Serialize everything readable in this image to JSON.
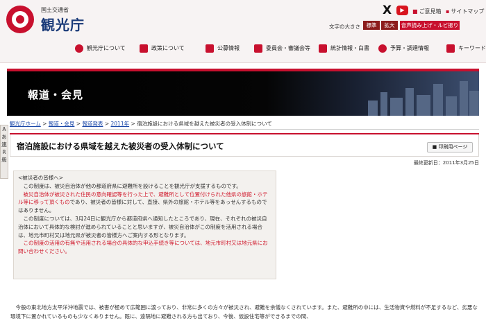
{
  "header": {
    "logo_sub": "国土交通省",
    "logo_main": "観光庁",
    "social_x": "X",
    "social_yt": "▶",
    "opinion_link": "ご意見箱",
    "sitemap_link": "サイトマップ",
    "font_size_label": "文字の大きさ",
    "font_normal": "標準",
    "font_large": "拡大",
    "voice_button": "音声読み上げ・ルビ振り"
  },
  "nav": {
    "items": [
      "観光庁について",
      "政策について",
      "公募情報",
      "委員会・審議会等",
      "統計情報・白書",
      "予算・調達情報",
      "キーワード"
    ]
  },
  "banner": {
    "title": "報道・会見"
  },
  "breadcrumb": [
    "観光庁ホーム",
    "報道・会見",
    "報道発表",
    "2011年",
    "宿泊施設における県域を越えた被災者の受入体制について"
  ],
  "breadcrumb_sep": ">",
  "side_tools": [
    "A",
    "あ",
    "連",
    "R",
    "般"
  ],
  "page": {
    "title": "宿泊施設における県域を越えた被災者の受入体制について",
    "print_button": "印刷用ページ",
    "updated": "最終更新日：2011年3月25日"
  },
  "notice": {
    "heading": "<被災者の皆様へ>",
    "p1": "　この制度は、被災自治体が他の都道府県に避難所を設けることを観光庁が支援するものです。",
    "p2_red": "　被災自治体が被災された住民の意向確認等を行った上で、避難所として位置付けられた他県の旅館・ホテル等に移って頂くもの",
    "p2_rest": "であり、被災者の皆様に対して、直接、県外の旅館・ホテル等をあっせんするものではありません。",
    "p3": "　この制度については、3月24日に観光庁から都道府県へ通知したところであり、現在、それぞれの被災自治体において具体的な検討が進められていることと思いますが、被災自治体がこの制度を活用される場合は、地元市町村又は地元県が被災者の皆様方へご案内する形となります。",
    "p4_red": "　この制度の活用の有無や活用される場合の具体的な申込手続き等については、地元市町村又は地元県にお問い合わせください。"
  },
  "body": {
    "text": "　今般の東北地方太平洋沖地震では、被害が極めて広範囲に渡っており、非常に多くの方々が被災され、避難を余儀なくされています。また、避難所の中には、生活物資や燃料が不足するなど、劣悪な環境下に置かれているものも少なくありません。既に、遠隔地に避難される方も出ており、今後、仮設住宅等ができるまでの間、"
  },
  "colors": {
    "brand_red": "#c8102e",
    "navy": "#1a3a78",
    "link": "#1a47a8"
  }
}
